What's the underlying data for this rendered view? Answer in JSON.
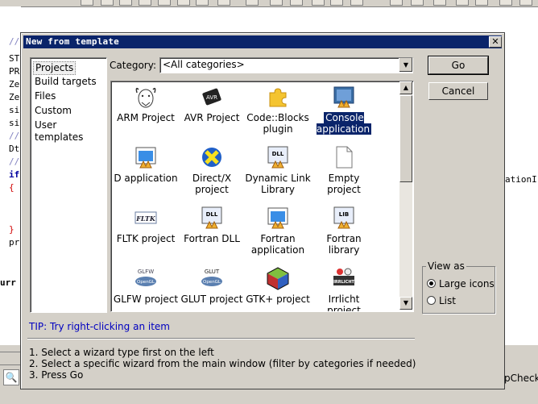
{
  "ide": {
    "code_lines": [
      "//",
      "ST",
      "PR",
      "Ze",
      "Ze",
      "si",
      "si",
      "//",
      "Dt",
      "//",
      "if",
      "{",
      "",
      "",
      "}",
      "pr",
      "",
      "",
      "urr"
    ],
    "right_text_1": "ationI",
    "right_text_2": "pCheck"
  },
  "dialog": {
    "title": "New from template",
    "close_label": "x",
    "left_panel": {
      "items": [
        "Projects",
        "Build targets",
        "Files",
        "Custom",
        "User templates"
      ],
      "selected": "Projects"
    },
    "category": {
      "label": "Category:",
      "value": "<All categories>"
    },
    "templates": [
      {
        "label": "ARM Project",
        "icon": "gnu-gnu-icon"
      },
      {
        "label": "AVR Project",
        "icon": "avr-chip-icon"
      },
      {
        "label": "Code::Blocks plugin",
        "icon": "puzzle-icon"
      },
      {
        "label": "Console application",
        "icon": "console-icon",
        "selected": true
      },
      {
        "label": "D application",
        "icon": "d-app-icon"
      },
      {
        "label": "Direct/X project",
        "icon": "directx-icon"
      },
      {
        "label": "Dynamic Link Library",
        "icon": "dll-icon"
      },
      {
        "label": "Empty project",
        "icon": "empty-file-icon"
      },
      {
        "label": "FLTK project",
        "icon": "fltk-icon"
      },
      {
        "label": "Fortran DLL",
        "icon": "fortran-dll-icon"
      },
      {
        "label": "Fortran application",
        "icon": "fortran-app-icon"
      },
      {
        "label": "Fortran library",
        "icon": "fortran-lib-icon"
      },
      {
        "label": "GLFW project",
        "icon": "glfw-icon"
      },
      {
        "label": "GLUT project",
        "icon": "glut-icon"
      },
      {
        "label": "GTK+ project",
        "icon": "gtk-icon"
      },
      {
        "label": "Irrlicht project",
        "icon": "irrlicht-icon"
      }
    ],
    "icon_texts": {
      "avr": "AVR",
      "dll": "DLL",
      "fltk": "FLTK",
      "lib": "LIB",
      "glfw": "GLFW",
      "glut": "GLUT",
      "opengl": "OpenGL",
      "irr": "IRRLICHT"
    },
    "buttons": {
      "go": "Go",
      "cancel": "Cancel"
    },
    "view_as": {
      "title": "View as",
      "options": [
        "Large icons",
        "List"
      ],
      "selected": "Large icons"
    },
    "tip": "TIP: Try right-clicking an item",
    "instructions": [
      "1. Select a wizard type first on the left",
      "2. Select a specific wizard from the main window (filter by categories if needed)",
      "3. Press Go"
    ]
  },
  "colors": {
    "title_bar": "#0a246a",
    "dialog_face": "#d4d0c8",
    "tip_text": "#0000c0",
    "selection": "#0a246a"
  }
}
